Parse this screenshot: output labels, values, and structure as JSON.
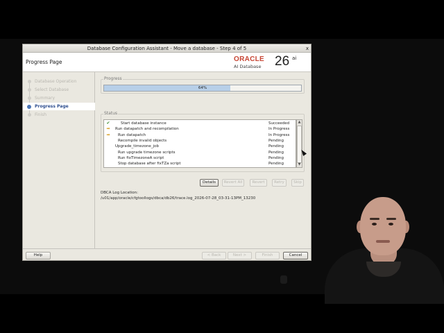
{
  "window": {
    "title": "Database Configuration Assistant - Move a database - Step 4 of 5",
    "close_glyph": "x"
  },
  "header": {
    "page_title": "Progress Page",
    "logo_brand": "ORACLE",
    "logo_product": "AI Database",
    "logo_version": "26",
    "logo_suffix": "ai"
  },
  "nav": {
    "items": [
      {
        "label": "Database Operation",
        "state": "done"
      },
      {
        "label": "Select Database",
        "state": "done"
      },
      {
        "label": "Summary",
        "state": "done"
      },
      {
        "label": "Progress Page",
        "state": "active"
      },
      {
        "label": "Finish",
        "state": "pending"
      }
    ]
  },
  "progress": {
    "group_label": "Progress",
    "percent_text": "64%",
    "fraction": 0.64
  },
  "status": {
    "group_label": "Status",
    "rows": [
      {
        "icon": "check-icon",
        "indent": 3,
        "name": "Start database instance",
        "status": "Succeeded"
      },
      {
        "icon": "in-progress-icon",
        "indent": 1,
        "name": "Run datapatch and recompilation",
        "status": "In Progress"
      },
      {
        "icon": "in-progress-icon",
        "indent": 2,
        "name": "Run datapatch",
        "status": "In Progress"
      },
      {
        "icon": "",
        "indent": 2,
        "name": "Recompile invalid objects",
        "status": "Pending"
      },
      {
        "icon": "",
        "indent": 1,
        "name": "Upgrade_timezone_job",
        "status": "Pending"
      },
      {
        "icon": "",
        "indent": 2,
        "name": "Run upgrade timezone scripts",
        "status": "Pending"
      },
      {
        "icon": "",
        "indent": 2,
        "name": "Run fixTimezoneA script",
        "status": "Pending"
      },
      {
        "icon": "",
        "indent": 2,
        "name": "Stop database after fixTZa script",
        "status": "Pending"
      }
    ]
  },
  "actions": {
    "details": "Details",
    "revert_all": "Revert All",
    "revert": "Revert",
    "retry": "Retry",
    "skip": "Skip"
  },
  "log": {
    "label": "DBCA Log Location:",
    "path": "/u01/app/oracle/cfgtoollogs/dbca/db26/trace.log_2026-07-28_03-31-13PM_13230"
  },
  "footer": {
    "help": "Help",
    "back": "< Back",
    "next": "Next >",
    "finish": "Finish",
    "cancel": "Cancel"
  },
  "colors": {
    "oracle_red": "#c74634",
    "progress_fill": "#b7cfe8",
    "active_nav": "#2f4f8f",
    "check_green": "#3a8a2e",
    "in_progress_amber": "#d8a128"
  }
}
